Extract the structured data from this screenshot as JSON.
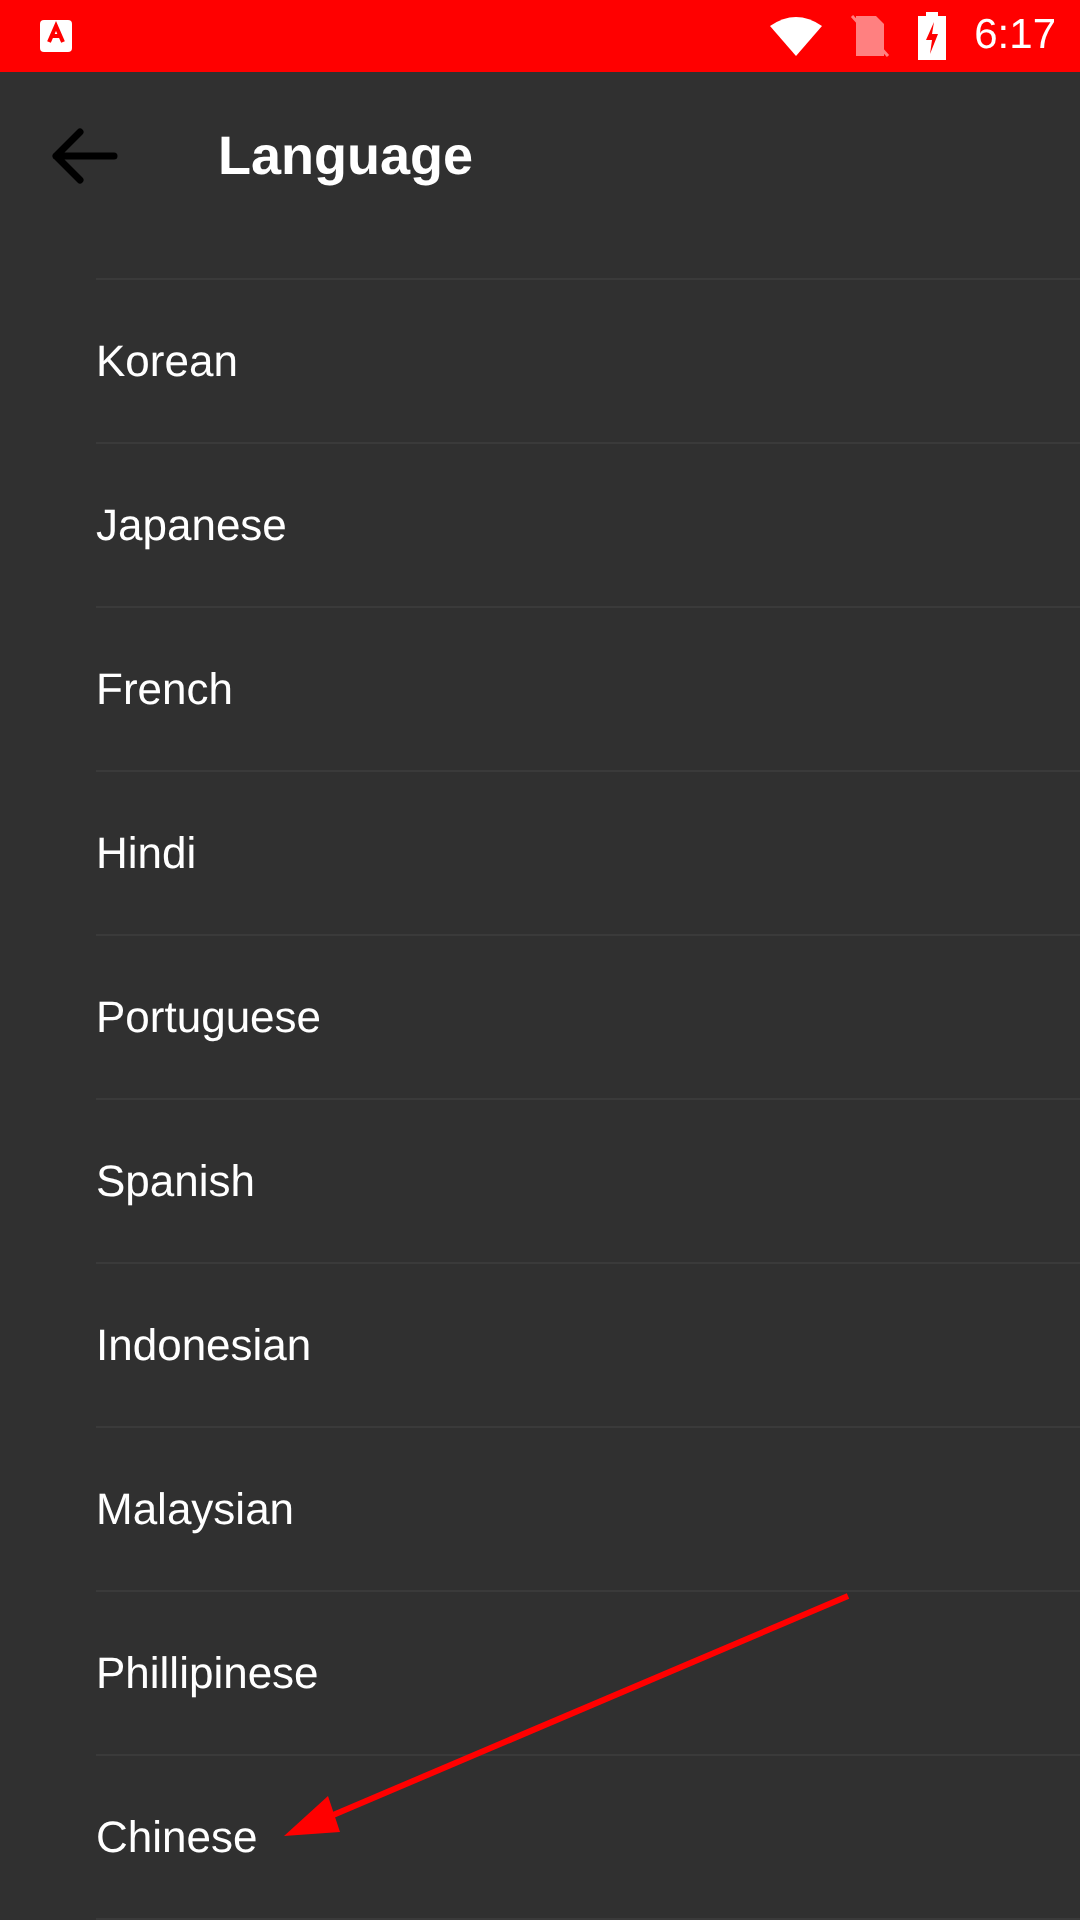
{
  "status_bar": {
    "time": "6:17"
  },
  "header": {
    "title": "Language"
  },
  "languages": [
    {
      "label": "Korean"
    },
    {
      "label": "Japanese"
    },
    {
      "label": "French"
    },
    {
      "label": "Hindi"
    },
    {
      "label": "Portuguese"
    },
    {
      "label": "Spanish"
    },
    {
      "label": "Indonesian"
    },
    {
      "label": "Malaysian"
    },
    {
      "label": "Phillipinese"
    },
    {
      "label": "Chinese"
    }
  ]
}
